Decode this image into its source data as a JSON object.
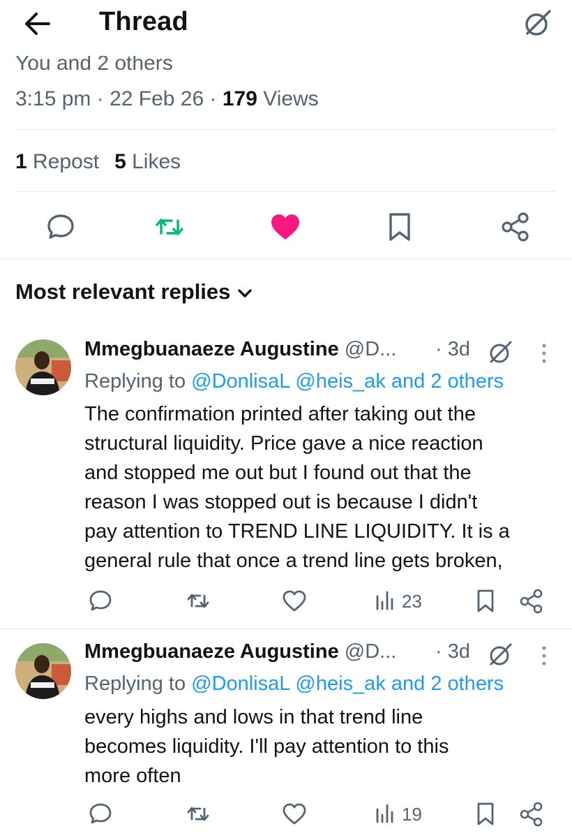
{
  "header": {
    "title": "Thread",
    "back_icon": "arrow-left-icon",
    "grok_icon": "grok-icon"
  },
  "post": {
    "clipped_line": "You and 2 others",
    "time": "3:15 pm",
    "date": "22 Feb 26",
    "views_count": "179",
    "views_label": "Views",
    "reposts_count": "1",
    "reposts_label": "Repost",
    "likes_count": "5",
    "likes_label": "Likes",
    "liked": true,
    "colors": {
      "repost": "#00ba7c",
      "like": "#f91880",
      "link": "#1d9bf0",
      "muted": "#536471"
    }
  },
  "replies_sort": {
    "label": "Most relevant replies"
  },
  "replies": [
    {
      "name": "Mmegbuanaeze Augustine",
      "handle": "@D...",
      "time": "· 3d",
      "replying_prefix": "Replying to",
      "replying_links": "@DonlisaL @heis_ak and 2 others",
      "lines": [
        "The confirmation printed after taking out the",
        "structural liquidity. Price gave a nice reaction",
        "and stopped me out but I found out that the",
        "reason I was stopped out is because I didn't",
        "pay attention to TREND LINE LIQUIDITY. It is a",
        "general rule that once a trend line gets broken,"
      ],
      "views": "23"
    },
    {
      "name": "Mmegbuanaeze Augustine",
      "handle": "@D...",
      "time": "· 3d",
      "replying_prefix": "Replying to",
      "replying_links": "@DonlisaL @heis_ak and 2 others",
      "lines": [
        "every highs and lows in that trend line",
        "becomes liquidity. I'll pay attention to this",
        "more often"
      ],
      "views": "19"
    }
  ]
}
